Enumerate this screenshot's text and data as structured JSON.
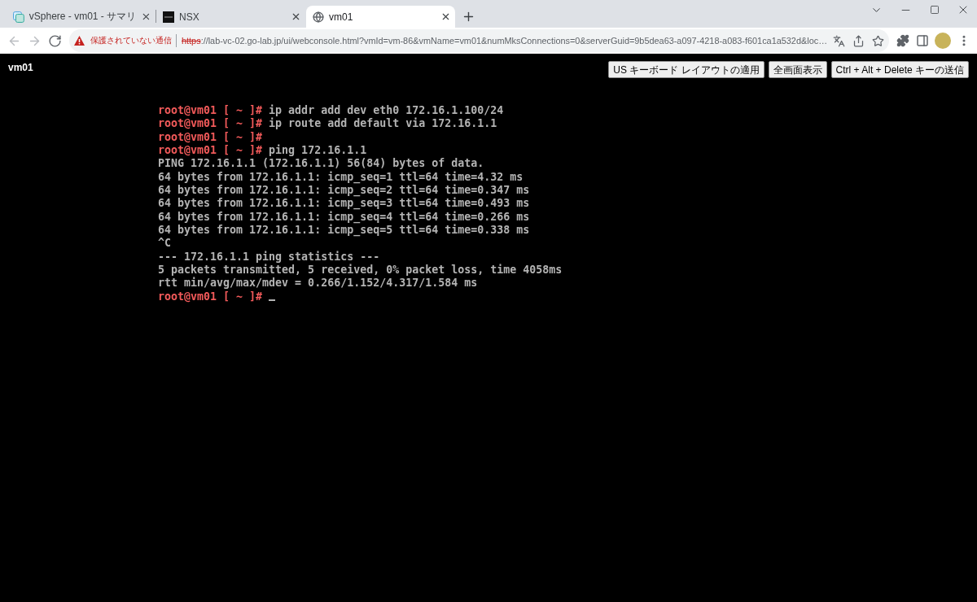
{
  "browser": {
    "tabs": [
      {
        "kind": "vsphere",
        "title": "vSphere - vm01 - サマリ",
        "selected": false
      },
      {
        "kind": "nsx",
        "title": "NSX",
        "selected": false
      },
      {
        "kind": "page",
        "title": "vm01",
        "selected": true
      }
    ],
    "nav_buttons": [
      {
        "kind": "back",
        "disabled": true
      },
      {
        "kind": "forward",
        "disabled": true
      },
      {
        "kind": "reload",
        "disabled": false
      }
    ],
    "address_bar": {
      "security_label": "保護されていない通信",
      "url_scheme": "https",
      "url_rest": "://lab-vc-02.go-lab.jp/ui/webconsole.html?vmId=vm-86&vmName=vm01&numMksConnections=0&serverGuid=9b5dea63-a097-4218-a083-f601ca1a532d&loc…"
    }
  },
  "console": {
    "title": "vm01",
    "buttons": [
      "US キーボード レイアウトの適用",
      "全画面表示",
      "Ctrl + Alt + Delete キーの送信"
    ],
    "terminal": {
      "lines": [
        {
          "kind": "prompt",
          "prompt": "root@vm01 [ ~ ]#",
          "command": "ip addr add dev eth0 172.16.1.100/24"
        },
        {
          "kind": "prompt",
          "prompt": "root@vm01 [ ~ ]#",
          "command": "ip route add default via 172.16.1.1"
        },
        {
          "kind": "prompt",
          "prompt": "root@vm01 [ ~ ]#"
        },
        {
          "kind": "prompt",
          "prompt": "root@vm01 [ ~ ]#",
          "command": "ping 172.16.1.1"
        },
        {
          "kind": "output",
          "text": "PING 172.16.1.1 (172.16.1.1) 56(84) bytes of data."
        },
        {
          "kind": "output",
          "text": "64 bytes from 172.16.1.1: icmp_seq=1 ttl=64 time=4.32 ms"
        },
        {
          "kind": "output",
          "text": "64 bytes from 172.16.1.1: icmp_seq=2 ttl=64 time=0.347 ms"
        },
        {
          "kind": "output",
          "text": "64 bytes from 172.16.1.1: icmp_seq=3 ttl=64 time=0.493 ms"
        },
        {
          "kind": "output",
          "text": "64 bytes from 172.16.1.1: icmp_seq=4 ttl=64 time=0.266 ms"
        },
        {
          "kind": "output",
          "text": "64 bytes from 172.16.1.1: icmp_seq=5 ttl=64 time=0.338 ms"
        },
        {
          "kind": "output",
          "text": "^C"
        },
        {
          "kind": "output",
          "text": "--- 172.16.1.1 ping statistics ---"
        },
        {
          "kind": "output",
          "text": "5 packets transmitted, 5 received, 0% packet loss, time 4058ms"
        },
        {
          "kind": "output",
          "text": "rtt min/avg/max/mdev = 0.266/1.152/4.317/1.584 ms"
        },
        {
          "kind": "prompt",
          "prompt": "root@vm01 [ ~ ]#"
        }
      ],
      "cursor": true
    }
  }
}
